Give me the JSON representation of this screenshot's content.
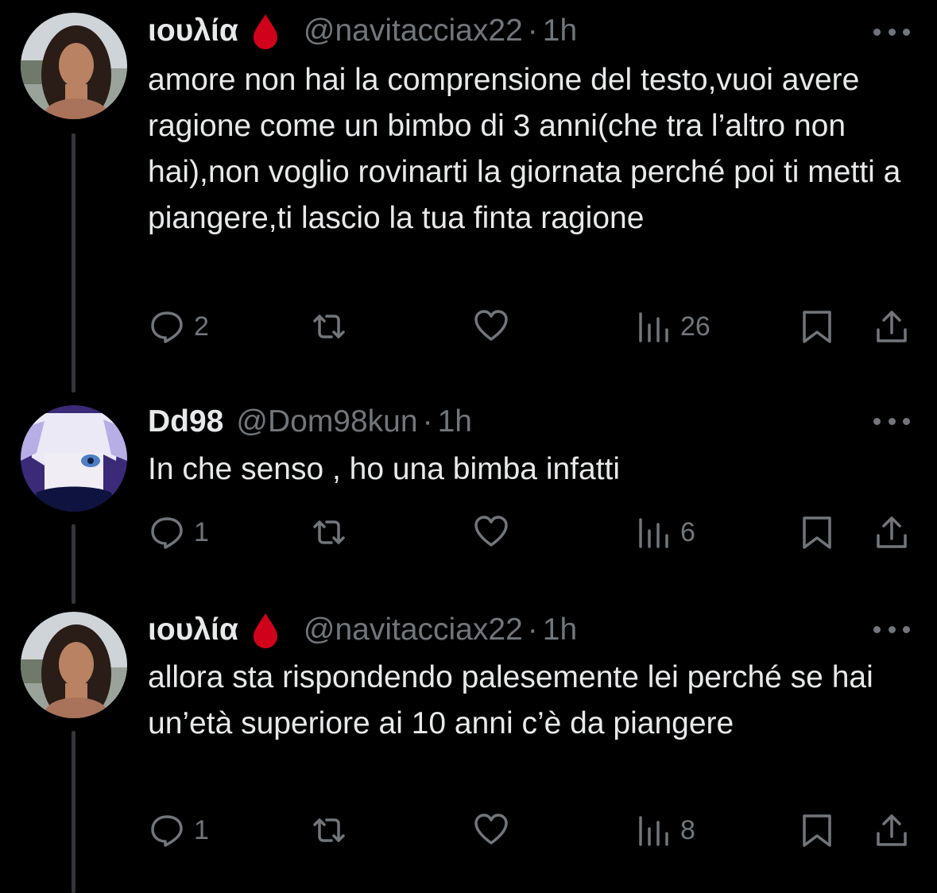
{
  "colors": {
    "background": "#000000",
    "text": "#e7e9ea",
    "muted": "#71767b",
    "thread_line": "#333639",
    "drop": "#d0021b"
  },
  "tweets": [
    {
      "name": "ιουλία",
      "emoji": "drop-of-blood",
      "handle": "@navitacciax22",
      "sep": "·",
      "time": "1h",
      "text": "amore non hai la comprensione del testo,vuoi avere ragione come un bimbo di 3 anni(che tra l’altro non hai),non voglio rovinarti la giornata perché poi ti metti a piangere,ti lascio la tua finta ragione",
      "replies": "2",
      "retweets": "",
      "likes": "",
      "views": "26"
    },
    {
      "name": "Dd98",
      "handle": "@Dom98kun",
      "sep": "·",
      "time": "1h",
      "text": "In che senso , ho una bimba infatti",
      "replies": "1",
      "retweets": "",
      "likes": "",
      "views": "6"
    },
    {
      "name": "ιουλία",
      "emoji": "drop-of-blood",
      "handle": "@navitacciax22",
      "sep": "·",
      "time": "1h",
      "text": "allora sta rispondendo palesemente lei perché se hai un’età superiore ai 10 anni c’è da piangere",
      "replies": "1",
      "retweets": "",
      "likes": "",
      "views": "8"
    }
  ]
}
